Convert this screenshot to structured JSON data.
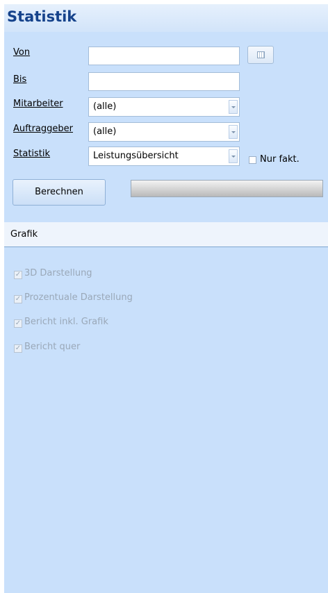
{
  "header": {
    "title": "Statistik"
  },
  "form": {
    "von": {
      "label": "Von",
      "value": ""
    },
    "bis": {
      "label": "Bis",
      "value": ""
    },
    "mitarbeiter": {
      "label": "Mitarbeiter",
      "value": "(alle)"
    },
    "auftraggeber": {
      "label": "Auftraggeber",
      "value": "(alle)"
    },
    "statistik": {
      "label": "Statistik",
      "value": "Leistungsübersicht"
    },
    "nur_fakt": {
      "label": "Nur fakt.",
      "checked": false
    }
  },
  "actions": {
    "berechnen_label": "Berechnen",
    "progress": 0
  },
  "grafik": {
    "title": "Grafik",
    "options": [
      {
        "label": "3D Darstellung",
        "checked": true
      },
      {
        "label": "Prozentuale Darstellung",
        "checked": true
      },
      {
        "label": "Bericht inkl. Grafik",
        "checked": true
      },
      {
        "label": "Bericht quer",
        "checked": true
      }
    ]
  },
  "colors": {
    "title": "#15428b",
    "panel": "#c9e0fb",
    "accent_border": "#7fa6d0"
  }
}
